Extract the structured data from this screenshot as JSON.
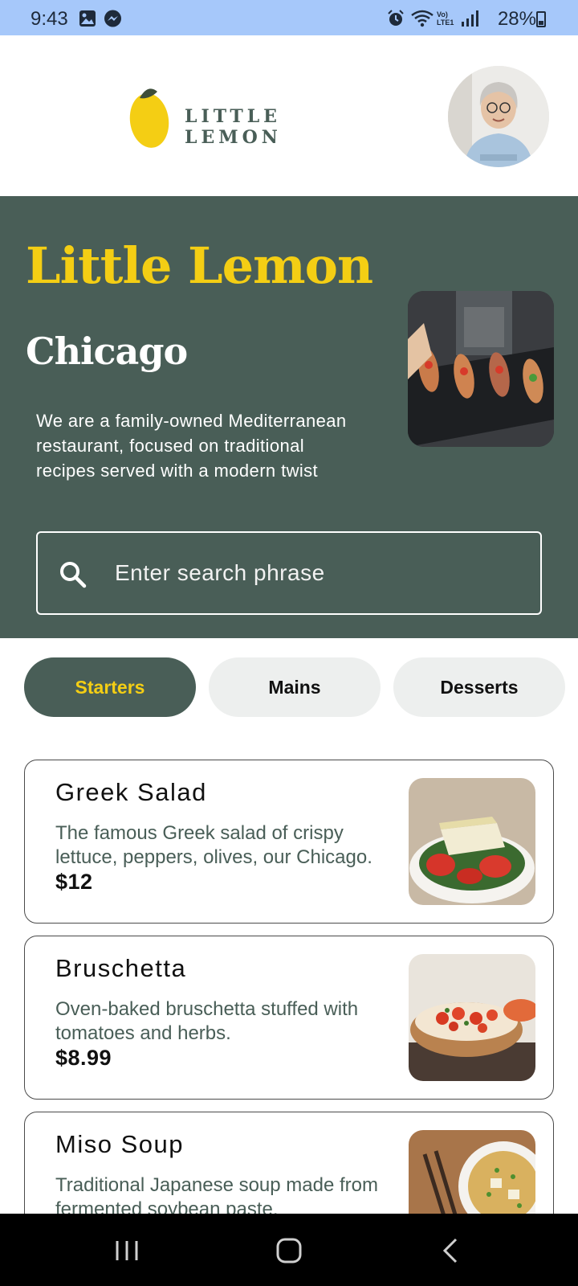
{
  "status_bar": {
    "time": "9:43",
    "battery": "28%",
    "left_icons": [
      "gallery-icon",
      "messenger-icon"
    ],
    "right_icons": [
      "alarm-icon",
      "wifi-icon",
      "volte-icon",
      "signal-icon",
      "battery-icon"
    ]
  },
  "header": {
    "logo_text": "LITTLE LEMON",
    "avatar": "profile-avatar"
  },
  "hero": {
    "title": "Little Lemon",
    "city": "Chicago",
    "description": "We are a family-owned Mediterranean restaurant, focused on traditional recipes served with a modern twist",
    "search_placeholder": "Enter search phrase"
  },
  "categories": [
    {
      "label": "Starters",
      "active": true
    },
    {
      "label": "Mains",
      "active": false
    },
    {
      "label": "Desserts",
      "active": false
    }
  ],
  "menu_items": [
    {
      "name": "Greek Salad",
      "description": "The famous Greek salad of crispy lettuce, peppers, olives, our Chicago.",
      "price": "$12"
    },
    {
      "name": "Bruschetta",
      "description": "Oven-baked bruschetta stuffed with tomatoes and herbs.",
      "price": "$8.99"
    },
    {
      "name": "Miso Soup",
      "description": "Traditional Japanese soup made from fermented soybean paste.",
      "price": ""
    }
  ],
  "nav_bar": {
    "icons": [
      "recent-apps-icon",
      "home-icon",
      "back-icon"
    ]
  },
  "colors": {
    "primary_green": "#495e57",
    "primary_yellow": "#f4ce14",
    "chip_background": "#edefee",
    "status_bar": "#a6c8fa"
  }
}
